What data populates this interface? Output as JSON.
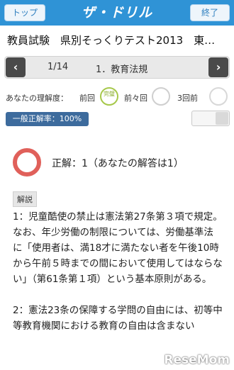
{
  "header": {
    "top_button": "トップ",
    "logo": "ザ・ドリル",
    "end_button": "終了"
  },
  "title": "教員試験　県別そっくりテスト2013　東…",
  "nav": {
    "prev": "‹",
    "next": "›",
    "position": "1/14",
    "category": "1．教育法規"
  },
  "understanding": {
    "label": "あなたの理解度：",
    "prev": "前回",
    "prev2": "前々回",
    "prev3": "3回前",
    "stamp_prev": "完璧"
  },
  "rate": "一般正解率：100%",
  "result": {
    "text": "正解：1（あなたの解答は1）"
  },
  "explanation": {
    "tag": "解説",
    "paragraphs": [
      "1：児童酷使の禁止は憲法第27条第３項で規定。なお、年少労働の制限については、労働基準法に「使用者は、満18才に満たない者を午後10時から午前５時までの間において使用してはならない」（第61条第１項）という基本原則がある。",
      "2：憲法23条の保障する学問の自由には、初等中等教育機関における教育の自由は含まない"
    ]
  },
  "watermark": "ReseMom"
}
